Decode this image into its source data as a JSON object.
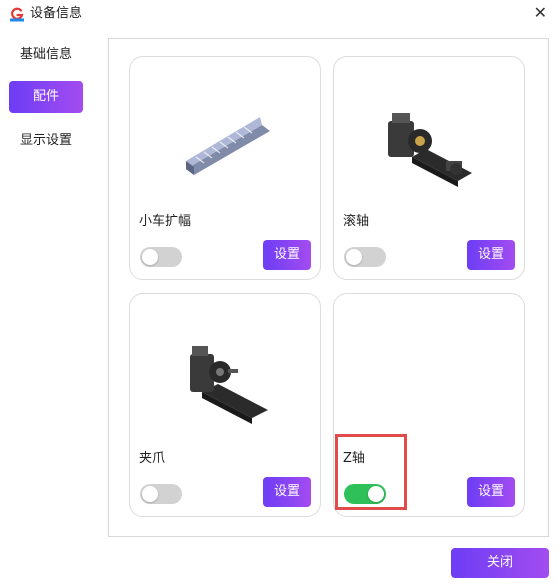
{
  "window": {
    "title": "设备信息",
    "close_glyph": "✕"
  },
  "sidebar": {
    "items": [
      {
        "label": "基础信息",
        "active": false
      },
      {
        "label": "配件",
        "active": true
      },
      {
        "label": "显示设置",
        "active": false
      }
    ]
  },
  "accessories": [
    {
      "name": "小车扩幅",
      "enabled": false,
      "settings_label": "设置",
      "image_icon": "carriage-extension-image"
    },
    {
      "name": "滚轴",
      "enabled": false,
      "settings_label": "设置",
      "image_icon": "roller-rotary-image"
    },
    {
      "name": "夹爪",
      "enabled": false,
      "settings_label": "设置",
      "image_icon": "chuck-rotary-image"
    },
    {
      "name": "Z轴",
      "enabled": true,
      "settings_label": "设置",
      "image_icon": ""
    }
  ],
  "footer": {
    "close_label": "关闭"
  },
  "colors": {
    "accent_start": "#6d3df5",
    "accent_end": "#a34cf0",
    "toggle_on": "#2fc05a",
    "highlight": "#e04b4b"
  }
}
